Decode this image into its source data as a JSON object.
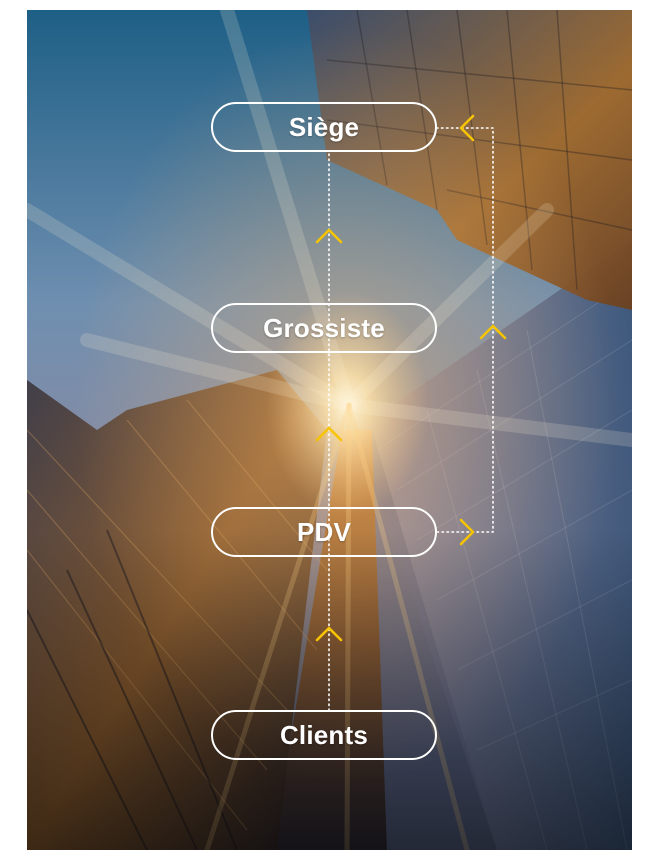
{
  "diagram": {
    "nodes": [
      {
        "id": "siege",
        "label": "Siège"
      },
      {
        "id": "grossiste",
        "label": "Grossiste"
      },
      {
        "id": "pdv",
        "label": "PDV"
      },
      {
        "id": "clients",
        "label": "Clients"
      }
    ],
    "edges": [
      {
        "from": "clients",
        "to": "pdv",
        "style": "dotted"
      },
      {
        "from": "pdv",
        "to": "grossiste",
        "style": "dotted"
      },
      {
        "from": "grossiste",
        "to": "siege",
        "style": "dotted"
      },
      {
        "from": "pdv",
        "to": "siege",
        "style": "dotted",
        "route": "right-bypass"
      }
    ]
  },
  "colors": {
    "arrow": "#f6c400",
    "line": "#ffffff",
    "node_border": "#ffffff",
    "node_text": "#ffffff"
  }
}
